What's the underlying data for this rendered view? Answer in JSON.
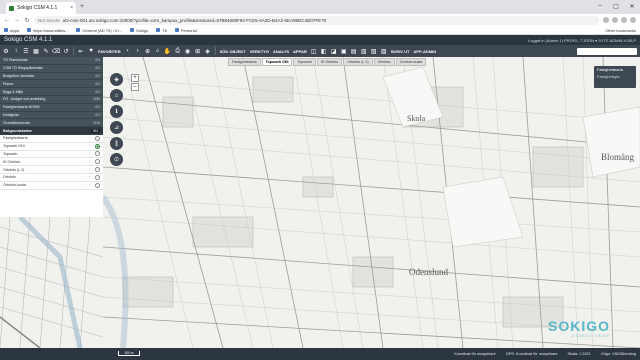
{
  "browser": {
    "tab_title": "Sokigo CSM 4.1.1",
    "tab_close": "×",
    "new_tab": "+",
    "url_security": "Not secure",
    "url": "utv-csm-001.utv.sokigo.com:10000/?profile=csm_kampus_profile&sessionid=67B84608F94-FCE5-4A2D-B4A2-6EA98DC4D07FE70",
    "bookmarks": [
      "Apps",
      "https://www.willkis...",
      "General (AD T5) / Ki...",
      "Sokigo",
      "T8",
      "Personal"
    ],
    "other_bookmarks": "Other bookmarks",
    "win_min": "–",
    "win_max": "▢",
    "win_close": "✕"
  },
  "app": {
    "title": "Sokigo CSM 4.1.1",
    "user_info": "Loggat in (Admin 1)   PROFIL: TJÖRN ▾   SYTE ADMIN   HJÄLP"
  },
  "toolbar": {
    "favorites": "FAVORITER",
    "menus": [
      "SÖK OBJEKT",
      "VERKTYG",
      "ANALYS",
      "APPAR"
    ],
    "right_menus": [
      "SKRIV UT",
      "APP-ADMIN"
    ]
  },
  "left_panel": {
    "layers": [
      {
        "label": "TÖ Planmosaik",
        "count": "0/0"
      },
      {
        "label": "CSM TÖ Ringspårsmatis",
        "count": "0/1"
      },
      {
        "label": "Budgetfon demokta",
        "count": "0/1"
      },
      {
        "label": "Planer",
        "count": "0/1"
      },
      {
        "label": "Bygg & Miljö",
        "count": "0/1"
      },
      {
        "label": "FÖ - budget och avdelning",
        "count": "0/50"
      },
      {
        "label": "Fastighetskarta NORM",
        "count": "0/1"
      },
      {
        "label": "Detaljplan",
        "count": "0/1"
      },
      {
        "label": "Översiktsinventa",
        "count": "0/16"
      },
      {
        "label": "Bakgrundskartor",
        "count": "0/1"
      }
    ],
    "backgrounds": [
      {
        "label": "Fastighetskarta",
        "selected": false
      },
      {
        "label": "Topoweb GHI",
        "selected": true
      },
      {
        "label": "Topoweb",
        "selected": false
      },
      {
        "label": "IK Orfofoto",
        "selected": false
      },
      {
        "label": "Ortofoto (L.2)",
        "selected": false
      },
      {
        "label": "Ortofoto",
        "selected": false
      },
      {
        "label": "Ortofoto-kusta",
        "selected": false
      }
    ]
  },
  "map": {
    "tabs": [
      "Fastighetskarta",
      "Topoweb GHI",
      "Topoweb",
      "IK Ortofoto",
      "Ortofoto (L.2)",
      "Ortofoto",
      "Ortofoto-kusta"
    ],
    "active_tab": 1,
    "layer_box": {
      "title": "Fastighetskarta",
      "sub": "Fastighetsyta"
    },
    "labels": {
      "skola": "Skola",
      "odenslund": "Odenslund",
      "bloma": "Blomäng"
    },
    "zoom_in": "+",
    "zoom_out": "–",
    "scale": "100 m"
  },
  "status": {
    "items": [
      "Koordinat för muspekare",
      "GPS: Koordinat för muspekare",
      "Skala: 1 2021",
      "Origo: VÄD/Blomäng"
    ]
  },
  "logo": {
    "name": "SOKIGO",
    "tagline": "A SOKIGO GROUP"
  },
  "colors": {
    "header": "#2b3640",
    "toolbar": "#3d4852",
    "panel_row": "#46525c",
    "accent_green": "#2e7d32",
    "logo": "#56b8c9"
  }
}
